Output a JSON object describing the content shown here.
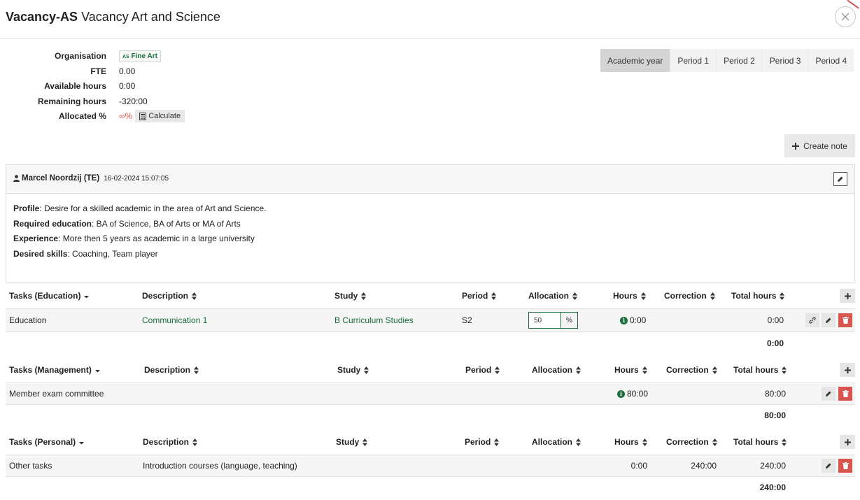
{
  "header": {
    "code": "Vacancy-AS",
    "name": "Vacancy Art and Science"
  },
  "info": {
    "organisation_label": "Organisation",
    "organisation_badge_prefix": "AS",
    "organisation_badge": "Fine Art",
    "fte_label": "FTE",
    "fte": "0.00",
    "available_label": "Available hours",
    "available": "0:00",
    "remaining_label": "Remaining hours",
    "remaining": "-320:00",
    "allocated_label": "Allocated %",
    "allocated": "∞%",
    "calculate_label": "Calculate"
  },
  "periods": [
    "Academic year",
    "Period 1",
    "Period 2",
    "Period 3",
    "Period 4"
  ],
  "active_period": "Academic year",
  "create_note_label": "Create note",
  "note": {
    "author": "Marcel Noordzij (TE)",
    "date": "16-02-2024 15:07:05",
    "lines": [
      {
        "label": "Profile",
        "text": ": Desire for a skilled academic in the area of Art and Science."
      },
      {
        "label": "Required education",
        "text": ": BA of Science, BA of Arts or MA of Arts"
      },
      {
        "label": "Experience",
        "text": ": More then 5 years as academic in a large university"
      },
      {
        "label": "Desired skills",
        "text": ": Coaching, Team player"
      }
    ]
  },
  "tables": {
    "education": {
      "headers": [
        "Tasks (Education)",
        "Description",
        "Study",
        "Period",
        "Allocation",
        "Hours",
        "Correction",
        "Total hours"
      ],
      "row": {
        "task": "Education",
        "description": "Communication 1",
        "study": "B Curriculum Studies",
        "period": "S2",
        "allocation": "50",
        "allocation_unit": "%",
        "hours": "0:00",
        "correction": "",
        "total": "0:00"
      },
      "total": "0:00"
    },
    "management": {
      "headers": [
        "Tasks (Management)",
        "Description",
        "Study",
        "Period",
        "Allocation",
        "Hours",
        "Correction",
        "Total hours"
      ],
      "row": {
        "task": "Member exam committee",
        "description": "",
        "study": "",
        "period": "",
        "hours": "80:00",
        "correction": "",
        "total": "80:00"
      },
      "total": "80:00"
    },
    "personal": {
      "headers": [
        "Tasks (Personal)",
        "Description",
        "Study",
        "Period",
        "Allocation",
        "Hours",
        "Correction",
        "Total hours"
      ],
      "row": {
        "task": "Other tasks",
        "description": "Introduction courses (language, teaching)",
        "study": "",
        "period": "",
        "hours": "0:00",
        "correction": "240:00",
        "total": "240:00"
      },
      "total": "240:00"
    }
  },
  "colors": {
    "accent": "#1a6e3a",
    "danger": "#d9534f",
    "header_bg": "#f5f5f5"
  }
}
